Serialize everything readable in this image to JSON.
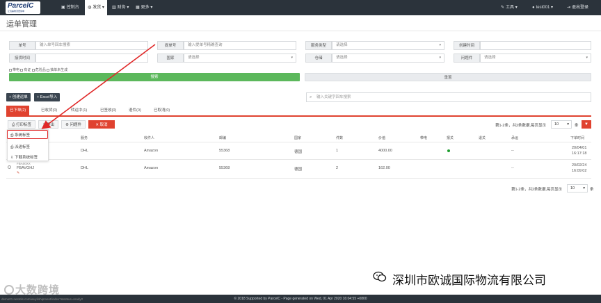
{
  "nav": {
    "logo_text": "ParcelC",
    "logo_sub": "让包裹物流更简单",
    "items": [
      {
        "label": "控制台",
        "icon": "dashboard-icon"
      },
      {
        "label": "发货 ▾",
        "icon": "globe-icon"
      },
      {
        "label": "财务 ▾",
        "icon": "chart-icon"
      },
      {
        "label": "更多 ▾",
        "icon": "grid-icon"
      }
    ],
    "tools": "工具 ▾",
    "user": "test001 ▾",
    "logout": "退出登录"
  },
  "page": {
    "title": "运单管理"
  },
  "filters": {
    "order_no": {
      "label": "单号",
      "placeholder": "输入单号回车搜索"
    },
    "bl_no": {
      "label": "提单号",
      "placeholder": "输入提单号精确查询"
    },
    "service_type": {
      "label": "服务类型",
      "value": "请选择"
    },
    "created_time": {
      "label": "创建时间",
      "value": ""
    },
    "received_time": {
      "label": "接货时间",
      "value": ""
    },
    "country": {
      "label": "国家",
      "value": "请选择"
    },
    "warehouse": {
      "label": "仓储",
      "value": "请选择"
    },
    "issue": {
      "label": "问题件",
      "value": "请选择"
    },
    "checks": [
      "带电",
      "有证",
      "危险品",
      "抽单未生成"
    ],
    "search_label": "搜索",
    "reset_label": "重置"
  },
  "toolbar": {
    "create_label": "+ 创建运单",
    "excel_label": "+ Excel导入",
    "keyword_placeholder": "输入关键字回车搜索"
  },
  "tabs": [
    {
      "label": "已下单(2)",
      "active": true
    },
    {
      "label": "已收货(0)",
      "active": false
    },
    {
      "label": "转运中(1)",
      "active": false
    },
    {
      "label": "已签收(0)",
      "active": false
    },
    {
      "label": "退件(0)",
      "active": false
    },
    {
      "label": "已取消(0)",
      "active": false
    }
  ],
  "actions": {
    "print_label": "打印标签",
    "export_label": "导出",
    "issue_label": "问题件",
    "cancel_label": "取消",
    "dropdown": [
      "系统标签",
      "派送标签",
      "下载系统标签"
    ]
  },
  "pager": {
    "top_text": "第1-2条，共2条数据,每页显示",
    "bottom_text": "第1-2条，共2条数据,每页显示",
    "per_page": "10",
    "unit": "条"
  },
  "table": {
    "headers": [
      "服务",
      "收件人",
      "邮编",
      "国家",
      "件数",
      "价值",
      "带电",
      "报关",
      "退关",
      "承运",
      "下单时间"
    ],
    "rows": [
      {
        "id": "",
        "service": "DHL",
        "recipient": "Amazon",
        "zip": "55368",
        "country": "德国",
        "pieces": "1",
        "value": "4000.00",
        "electric": "",
        "customs": true,
        "returned": "",
        "carrier": "--",
        "date": "20/04/01",
        "time": "16:17:18"
      },
      {
        "id": "FBAVGHJ",
        "id_prefix": "FBA00XX",
        "service": "DHL",
        "recipient": "Amazon",
        "zip": "55368",
        "country": "德国",
        "pieces": "2",
        "value": "162.00",
        "electric": "",
        "customs": false,
        "returned": "",
        "carrier": "--",
        "date": "20/02/24",
        "time": "16:09:02"
      }
    ]
  },
  "footer": {
    "text": "© 2018 Supported by ParcelC - Page generated on Wed, 01 Apr 2020 16:04:55 +0800",
    "status_url": "demo01.nestols.com/wuyi/shipment/index?&status=ready#"
  },
  "watermark": {
    "left": "大数跨境",
    "right": "深圳市欧诚国际物流有限公司"
  },
  "colors": {
    "accent": "#e0422f",
    "green": "#5cb85c",
    "nav": "#2b333b"
  }
}
